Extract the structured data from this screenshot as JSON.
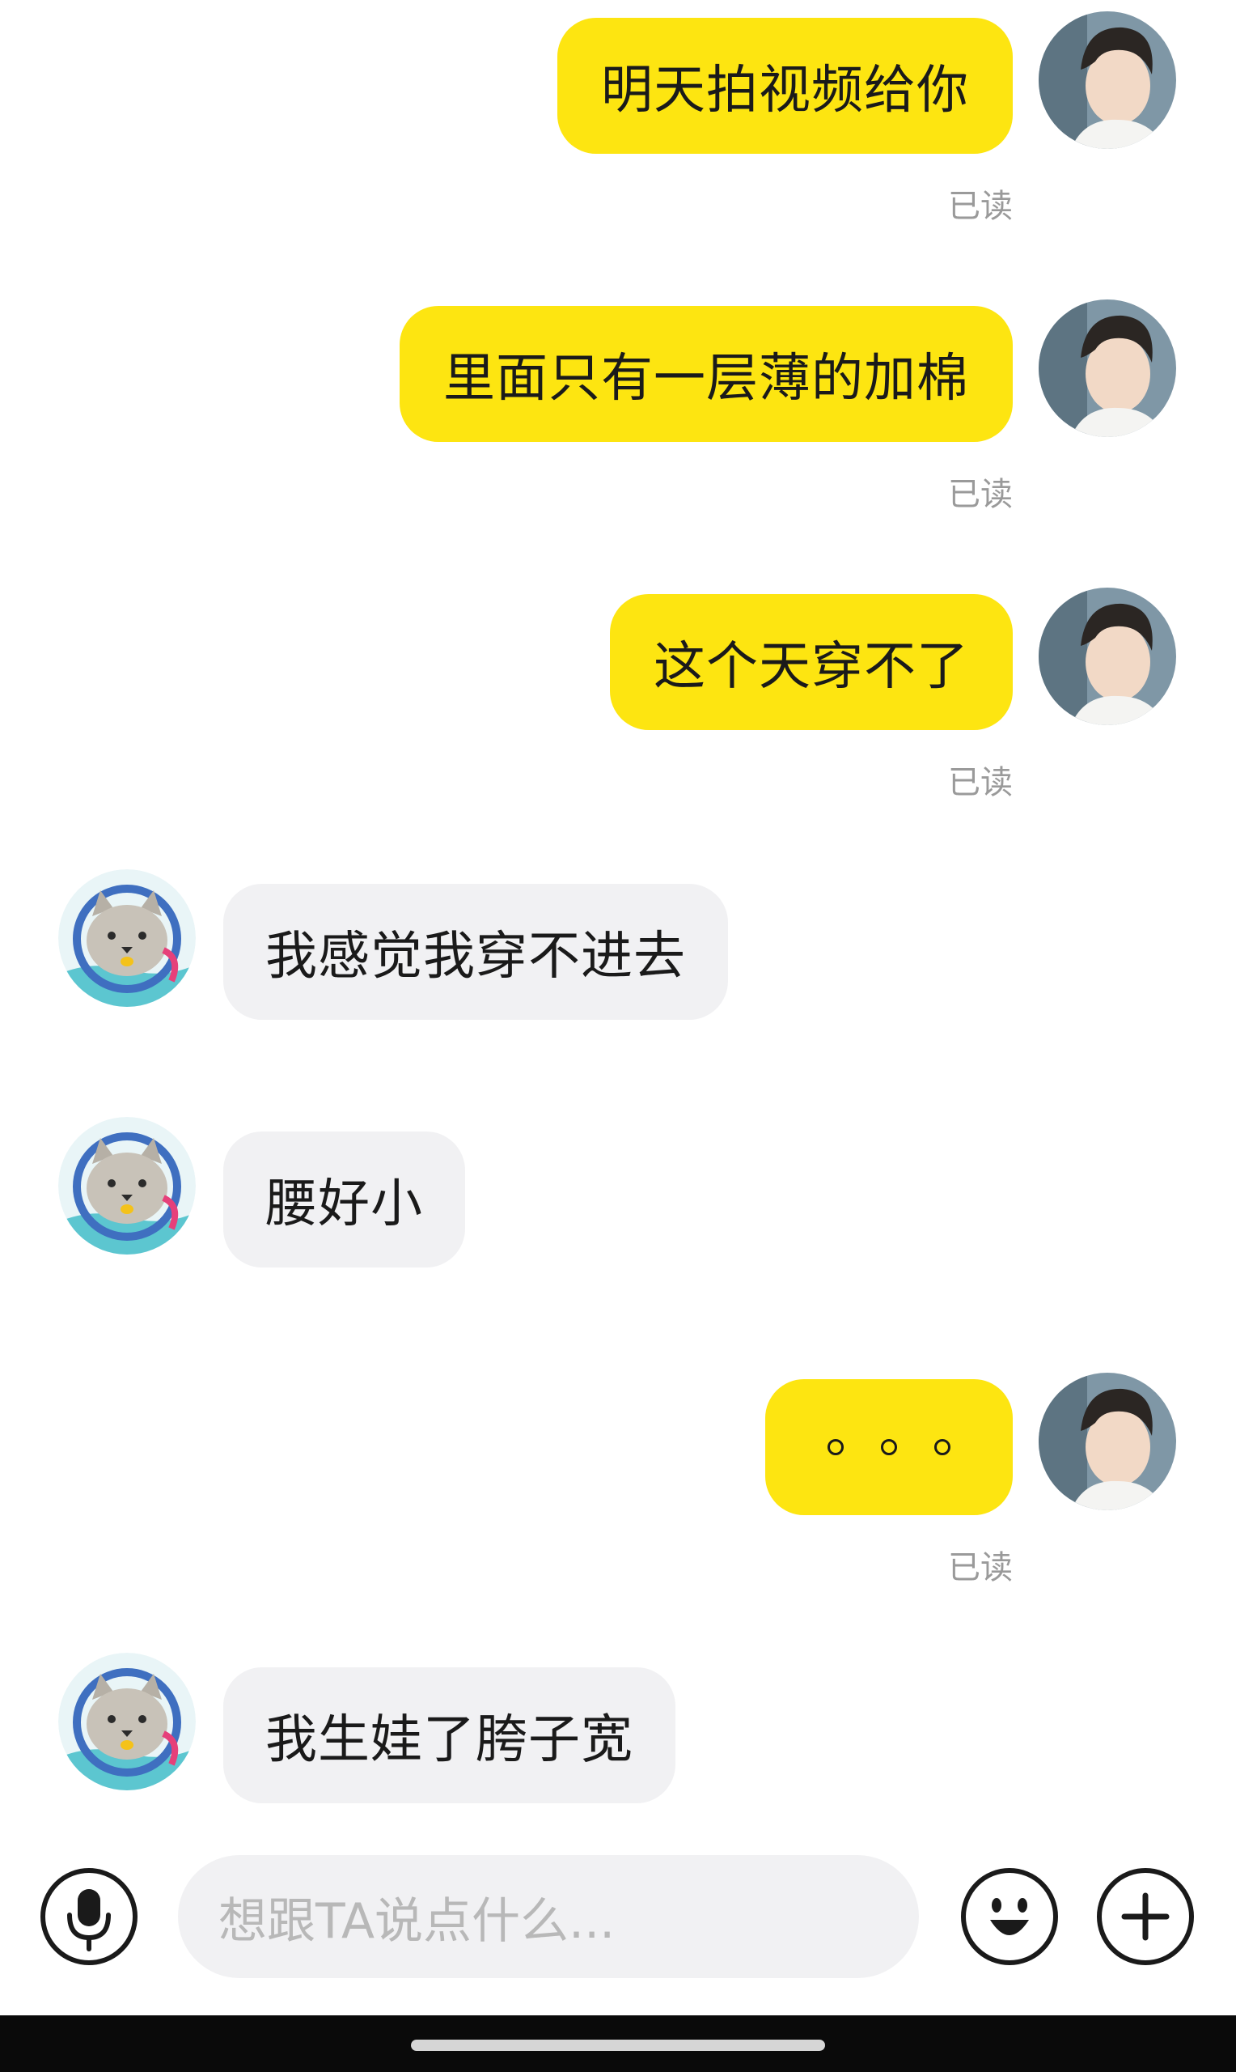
{
  "messages": [
    {
      "direction": "out",
      "text": "明天拍视频给你",
      "status": "已读",
      "avatar_icon": "user-avatar-icon"
    },
    {
      "direction": "out",
      "text": "里面只有一层薄的加棉",
      "status": "已读",
      "avatar_icon": "user-avatar-icon"
    },
    {
      "direction": "out",
      "text": "这个天穿不了",
      "status": "已读",
      "avatar_icon": "user-avatar-icon"
    },
    {
      "direction": "in",
      "text": "我感觉我穿不进去",
      "avatar_icon": "cat-avatar-icon"
    },
    {
      "direction": "in",
      "text": "腰好小",
      "avatar_icon": "cat-avatar-icon"
    },
    {
      "direction": "out",
      "text": "。。。",
      "status": "已读",
      "avatar_icon": "user-avatar-icon"
    },
    {
      "direction": "in",
      "text": "我生娃了胯子宽",
      "avatar_icon": "cat-avatar-icon"
    }
  ],
  "input_bar": {
    "placeholder": "想跟TA说点什么...",
    "voice_icon": "microphone-icon",
    "emoji_icon": "emoji-icon",
    "more_icon": "plus-icon"
  },
  "colors": {
    "outgoing_bubble": "#fde511",
    "incoming_bubble": "#f1f1f3",
    "read_receipt": "#9a9a9a",
    "placeholder": "#b8b8b8"
  }
}
